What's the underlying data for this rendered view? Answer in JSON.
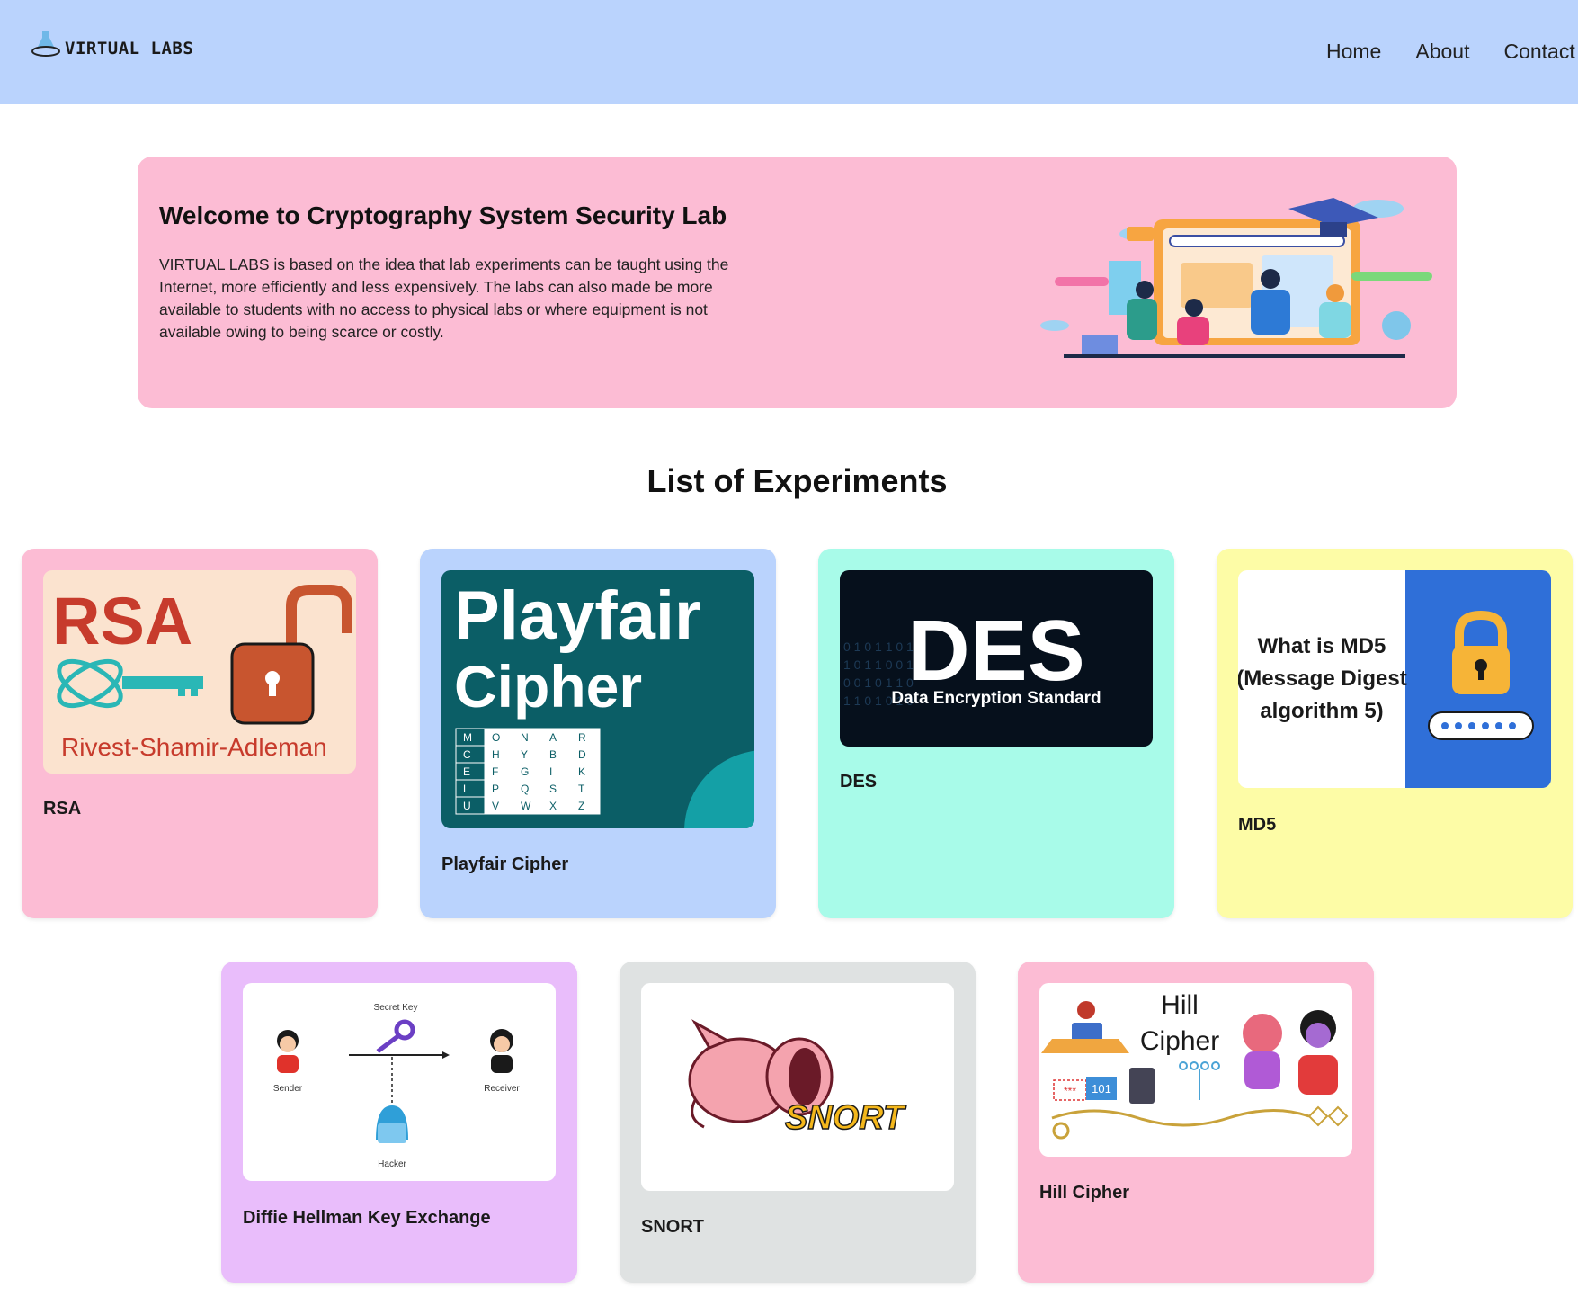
{
  "navbar": {
    "brand": "VIRTUAL LABS",
    "links": [
      "Home",
      "About",
      "Contact"
    ]
  },
  "hero": {
    "title": "Welcome to Cryptography System Security Lab",
    "description": "VIRTUAL LABS is based on the idea that lab experiments can be taught using the Internet, more efficiently and less expensively. The labs can also made be more available to students with no access to physical labs or where equipment is not available owing to being scarce or costly."
  },
  "experiments": {
    "title": "List of Experiments",
    "items": [
      {
        "label": "RSA",
        "color": "#fcbcd4"
      },
      {
        "label": "Playfair Cipher",
        "color": "#bad3fd"
      },
      {
        "label": "DES",
        "color": "#a8fbe9"
      },
      {
        "label": "MD5",
        "color": "#fdfca6"
      },
      {
        "label": "Diffie Hellman Key Exchange",
        "color": "#e9bdfb"
      },
      {
        "label": "SNORT",
        "color": "#dfe2e2"
      },
      {
        "label": "Hill Cipher",
        "color": "#fcbcd4"
      }
    ]
  },
  "thumbnails": {
    "rsa": {
      "big": "RSA",
      "caption": "Rivest-Shamir-Adleman"
    },
    "playfair": {
      "line1": "Playfair",
      "line2": "Cipher",
      "grid": [
        [
          "M",
          "O",
          "N",
          "A",
          "R"
        ],
        [
          "C",
          "H",
          "Y",
          "B",
          "D"
        ],
        [
          "E",
          "F",
          "G",
          "I",
          "K"
        ],
        [
          "L",
          "P",
          "Q",
          "S",
          "T"
        ],
        [
          "U",
          "V",
          "W",
          "X",
          "Z"
        ]
      ]
    },
    "des": {
      "big": "DES",
      "caption": "Data Encryption Standard"
    },
    "md5": {
      "line1": "What is MD5",
      "line2": "(Message Digest",
      "line3": "algorithm 5)"
    },
    "diffie": {
      "secret": "Secret Key",
      "sender": "Sender",
      "receiver": "Receiver",
      "hacker": "Hacker"
    },
    "snort": {
      "word": "SNORT"
    },
    "hill": {
      "line1": "Hill",
      "line2": "Cipher",
      "code": "101",
      "stars": "***"
    }
  }
}
